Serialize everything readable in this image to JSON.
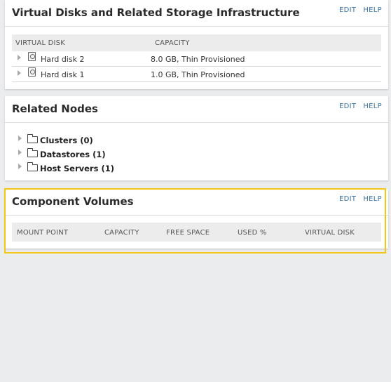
{
  "virtual_disks": {
    "title": "Virtual Disks and Related Storage Infrastructure",
    "edit_label": "EDIT",
    "help_label": "HELP",
    "columns": [
      "VIRTUAL DISK",
      "CAPACITY"
    ],
    "rows": [
      {
        "name": "Hard disk 2",
        "capacity": "8.0 GB, Thin Provisioned"
      },
      {
        "name": "Hard disk 1",
        "capacity": "1.0 GB, Thin Provisioned"
      }
    ]
  },
  "related_nodes": {
    "title": "Related Nodes",
    "edit_label": "EDIT",
    "help_label": "HELP",
    "nodes": [
      {
        "label": "Clusters (0)"
      },
      {
        "label": "Datastores (1)"
      },
      {
        "label": "Host Servers (1)"
      }
    ]
  },
  "component_volumes": {
    "title": "Component Volumes",
    "edit_label": "EDIT",
    "help_label": "HELP",
    "columns": [
      "MOUNT POINT",
      "CAPACITY",
      "FREE SPACE",
      "USED %",
      "VIRTUAL DISK"
    ]
  },
  "colors": {
    "background": "#ebecee",
    "link": "#3a73a5",
    "highlight": "#f3c615"
  }
}
